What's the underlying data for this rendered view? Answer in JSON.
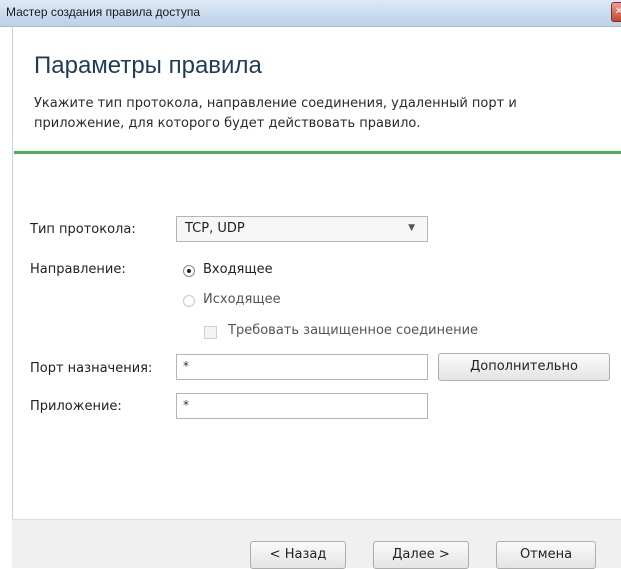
{
  "window": {
    "title": "Мастер создания правила доступа",
    "close_glyph": "✕"
  },
  "header": {
    "title": "Параметры правила",
    "subtitle": "Укажите тип протокола, направление соединения, удаленный порт и приложение, для которого будет действовать правило."
  },
  "form": {
    "protocol_label": "Тип протокола:",
    "protocol_value": "TCP, UDP",
    "direction_label": "Направление:",
    "direction_options": [
      {
        "label": "Входящее",
        "selected": true
      },
      {
        "label": "Исходящее",
        "selected": false
      }
    ],
    "secure_label": "Требовать защищенное соединение",
    "port_label": "Порт назначения:",
    "port_value": "*",
    "advanced_button": "Дополнительно",
    "app_label": "Приложение:",
    "app_value": "*"
  },
  "footer": {
    "back": "< Назад",
    "next": "Далее >",
    "cancel": "Отмена"
  },
  "colors": {
    "accent_line": "#4cb054",
    "heading": "#1f3c58"
  }
}
